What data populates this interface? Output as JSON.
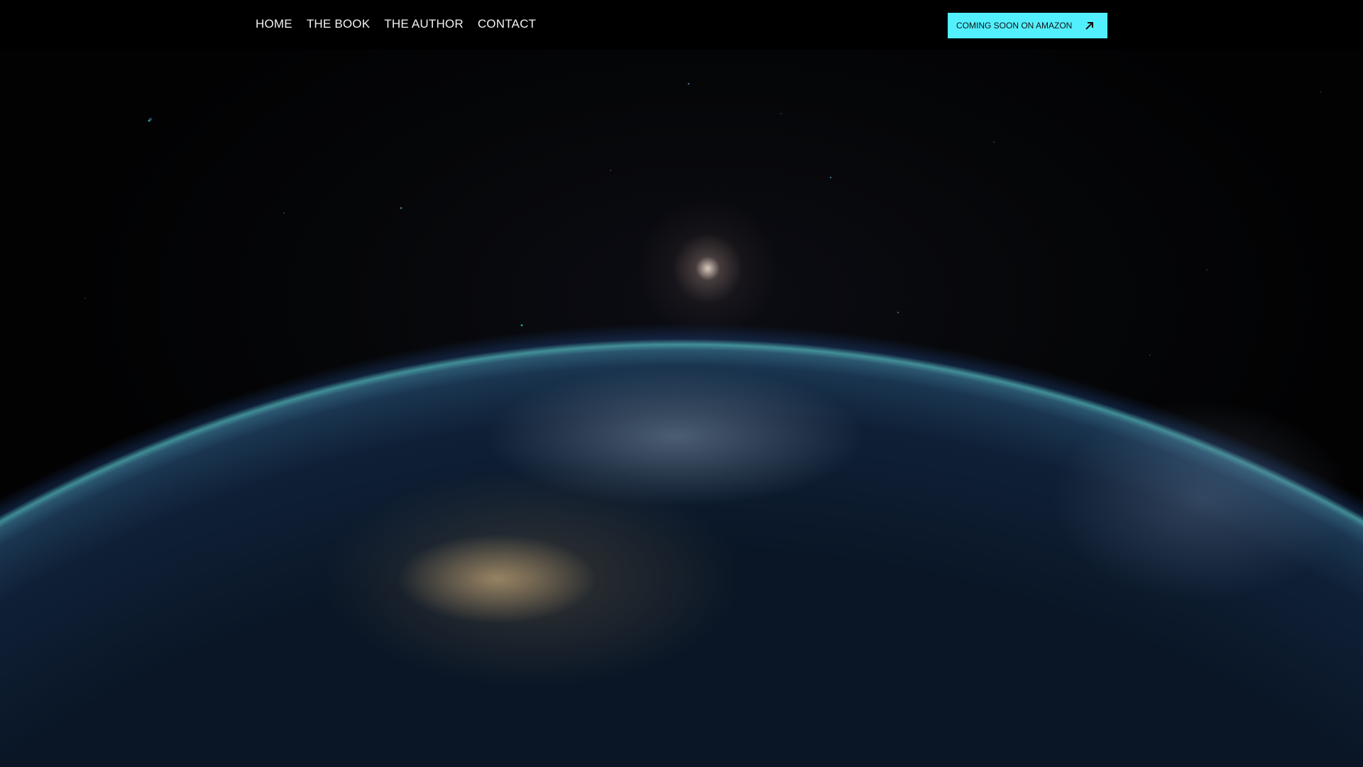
{
  "nav": {
    "items": [
      {
        "label": "HOME"
      },
      {
        "label": "THE BOOK"
      },
      {
        "label": "THE AUTHOR"
      },
      {
        "label": "CONTACT"
      }
    ]
  },
  "cta": {
    "label": "COMING SOON ON AMAZON",
    "icon": "arrow-up-right-icon",
    "color": "#52f0ff"
  }
}
